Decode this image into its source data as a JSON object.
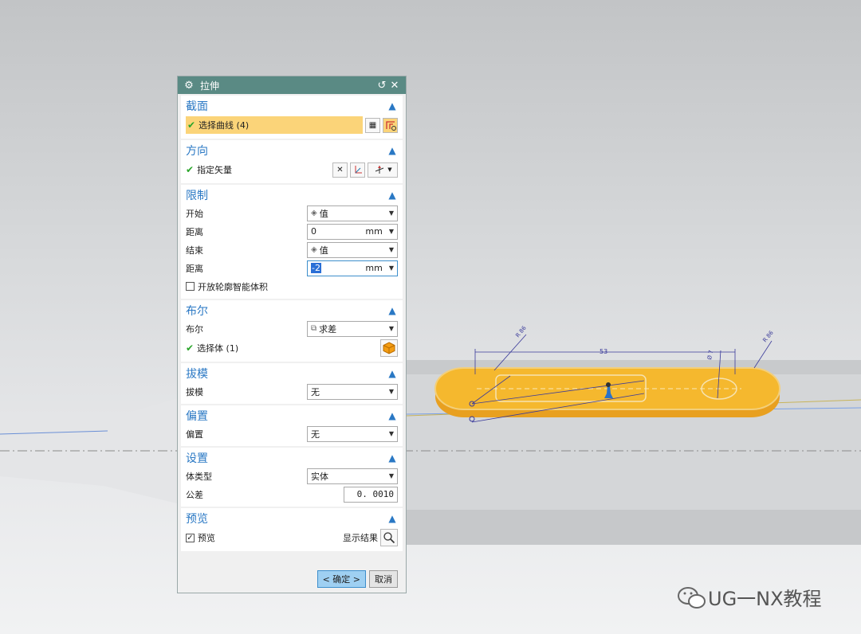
{
  "dialog": {
    "title": "拉伸",
    "sections": {
      "section": {
        "title": "截面",
        "select_curve": "选择曲线 (4)"
      },
      "direction": {
        "title": "方向",
        "specify_vector": "指定矢量"
      },
      "limits": {
        "title": "限制",
        "start_label": "开始",
        "start_value": "值",
        "distance1_label": "距离",
        "distance1_value": "0",
        "distance1_unit": "mm",
        "end_label": "结束",
        "end_value": "值",
        "distance2_label": "距离",
        "distance2_value": "-2",
        "distance2_unit": "mm",
        "open_profile_label": "开放轮廓智能体积"
      },
      "boolean": {
        "title": "布尔",
        "boolean_label": "布尔",
        "boolean_value": "求差",
        "select_body": "选择体 (1)"
      },
      "draft": {
        "title": "拔模",
        "draft_label": "拔模",
        "draft_value": "无"
      },
      "offset": {
        "title": "偏置",
        "offset_label": "偏置",
        "offset_value": "无"
      },
      "settings": {
        "title": "设置",
        "body_type_label": "体类型",
        "body_type_value": "实体",
        "tolerance_label": "公差",
        "tolerance_value": "0. 0010"
      },
      "preview": {
        "title": "预览",
        "preview_label": "预览",
        "show_result_label": "显示结果"
      }
    },
    "buttons": {
      "ok": "< 确定 >",
      "cancel": "取消"
    }
  },
  "model": {
    "dim_53": "53",
    "dim_top_left": "R 86",
    "dim_top_right": "R 86",
    "dim_circle": "Ø 7"
  },
  "watermark": "UG一NX教程",
  "colors": {
    "accent": "#2a78c4",
    "slot": "#f5b82e",
    "selection": "#fbd479",
    "titlebar": "#5a8a84"
  }
}
